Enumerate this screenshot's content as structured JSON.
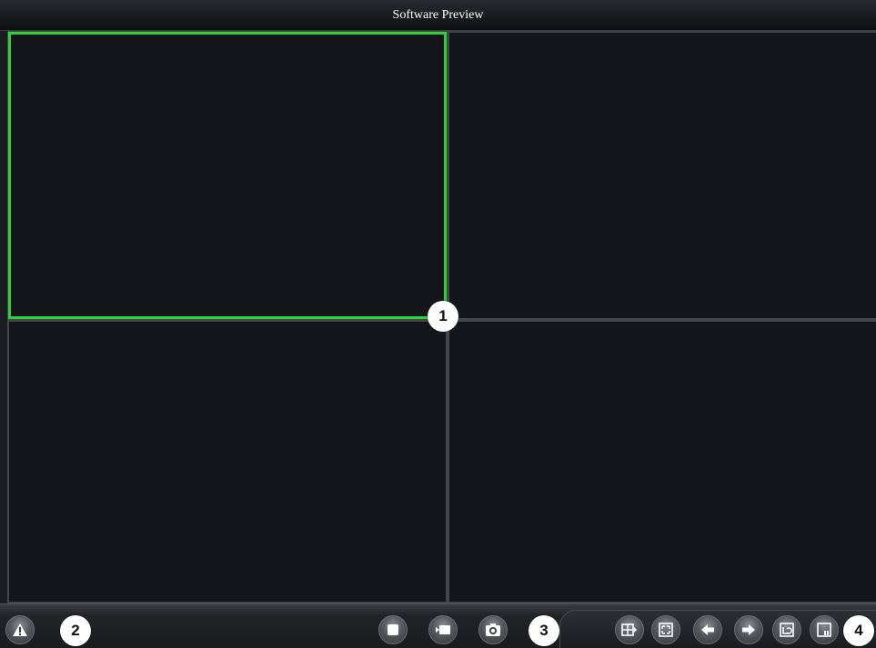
{
  "window": {
    "title": "Software Preview"
  },
  "grid": {
    "layout": "2x2",
    "selected_pane": 1,
    "selected_color": "#2fd13a"
  },
  "callouts": {
    "c1": "1",
    "c2": "2",
    "c3": "3",
    "c4": "4"
  },
  "toolbar": {
    "left_buttons": [
      {
        "icon": "alarm-warning-icon"
      }
    ],
    "center_buttons": [
      {
        "icon": "stop-icon"
      },
      {
        "icon": "record-icon"
      },
      {
        "icon": "snapshot-camera-icon"
      }
    ],
    "right_buttons": [
      {
        "icon": "split-screen-icon"
      },
      {
        "icon": "fullscreen-icon"
      },
      {
        "icon": "previous-page-icon"
      },
      {
        "icon": "next-page-icon"
      },
      {
        "icon": "restore-layout-icon"
      },
      {
        "icon": "window-layout-icon"
      }
    ]
  }
}
